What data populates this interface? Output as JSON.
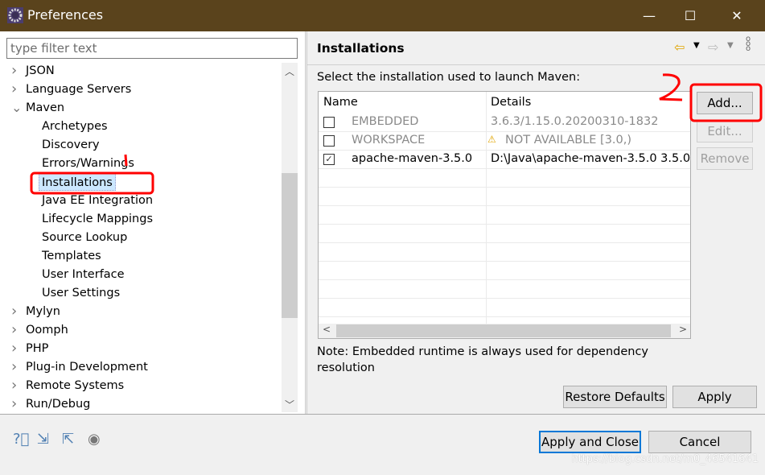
{
  "window": {
    "title": "Preferences",
    "icon": "eclipse-gear-icon",
    "minimize": "—",
    "maximize": "☐",
    "close": "✕"
  },
  "filter": {
    "placeholder": "type filter text"
  },
  "tree": [
    {
      "label": "JSON",
      "level": 0,
      "expanded": false
    },
    {
      "label": "Language Servers",
      "level": 0,
      "expanded": false
    },
    {
      "label": "Maven",
      "level": 0,
      "expanded": true
    },
    {
      "label": "Archetypes",
      "level": 1
    },
    {
      "label": "Discovery",
      "level": 1
    },
    {
      "label": "Errors/Warnings",
      "level": 1
    },
    {
      "label": "Installations",
      "level": 1,
      "selected": true
    },
    {
      "label": "Java EE Integration",
      "level": 1
    },
    {
      "label": "Lifecycle Mappings",
      "level": 1
    },
    {
      "label": "Source Lookup",
      "level": 1
    },
    {
      "label": "Templates",
      "level": 1
    },
    {
      "label": "User Interface",
      "level": 1
    },
    {
      "label": "User Settings",
      "level": 1
    },
    {
      "label": "Mylyn",
      "level": 0,
      "expanded": false
    },
    {
      "label": "Oomph",
      "level": 0,
      "expanded": false
    },
    {
      "label": "PHP",
      "level": 0,
      "expanded": false
    },
    {
      "label": "Plug-in Development",
      "level": 0,
      "expanded": false
    },
    {
      "label": "Remote Systems",
      "level": 0,
      "expanded": false
    },
    {
      "label": "Run/Debug",
      "level": 0,
      "expanded": false
    }
  ],
  "page": {
    "title": "Installations",
    "instruction": "Select the installation used to launch Maven:",
    "columns": [
      "Name",
      "Details"
    ],
    "rows": [
      {
        "name": "EMBEDDED",
        "details": "3.6.3/1.15.0.20200310-1832",
        "checked": false,
        "disabled": true,
        "warning": false
      },
      {
        "name": "WORKSPACE",
        "details": "NOT AVAILABLE [3.0,)",
        "checked": false,
        "disabled": true,
        "warning": true
      },
      {
        "name": "apache-maven-3.5.0",
        "details": "D:\\Java\\apache-maven-3.5.0 3.5.0",
        "checked": true,
        "disabled": false,
        "warning": false
      }
    ],
    "buttons": {
      "add": "Add...",
      "edit": "Edit...",
      "remove": "Remove"
    },
    "note_line1": "Note: Embedded runtime is always used for dependency",
    "note_line2": "resolution",
    "restore_defaults": "Restore Defaults",
    "apply": "Apply"
  },
  "footer": {
    "apply_close": "Apply and Close",
    "cancel": "Cancel",
    "icons": [
      "help-icon",
      "import-icon",
      "export-icon",
      "record-icon"
    ]
  },
  "annotations": {
    "color": "#ff0000",
    "step_label": "2"
  },
  "watermark": "https://blog.csdn.net/m0_46541641",
  "colors": {
    "titlebar": "#5a431c",
    "selection": "#cce8ff",
    "default_button_border": "#0078d7"
  }
}
